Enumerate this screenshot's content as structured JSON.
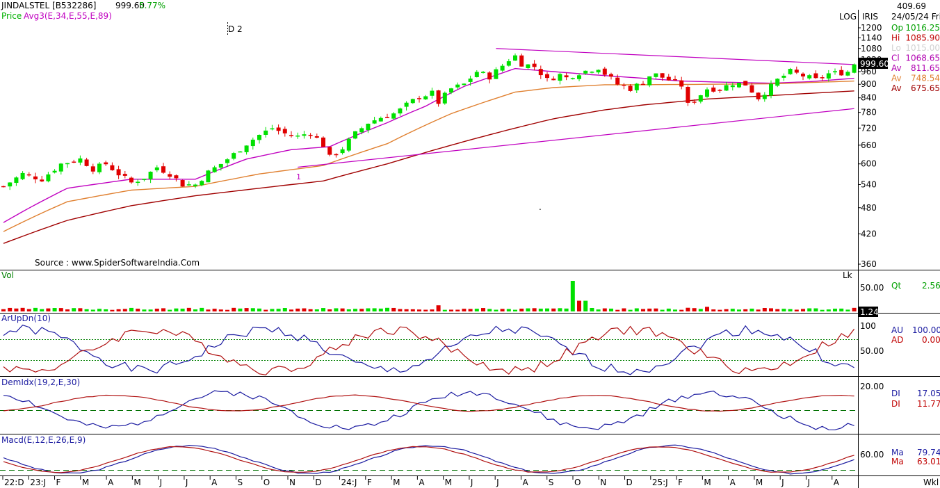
{
  "header": {
    "symbol": "JINDALSTEL [B532286]",
    "last": "999.60",
    "change_pct": "5.77%",
    "price_label": "Price",
    "avg_label": "Avg3(E,34,E,55,E,89)",
    "marker": "D 2",
    "wave_label": "1",
    "source": "Source : www.SpiderSoftwareIndia.Com",
    "dot": "."
  },
  "right_panel": {
    "volume_top": "409.69",
    "date": "24/05/24 Fri",
    "log_label": "LOG",
    "iris_label": "IRIS",
    "rows": [
      {
        "label": "Op",
        "value": "1016.25",
        "color": "#00a000"
      },
      {
        "label": "Hi",
        "value": "1085.90",
        "color": "#c00000"
      },
      {
        "label": "Lo",
        "value": "1015.00",
        "color": "#d0d0d0"
      },
      {
        "label": "Cl",
        "value": "1068.65",
        "color": "#b000b0"
      },
      {
        "label": "Av",
        "value": "811.65",
        "color": "#b000b0"
      },
      {
        "label": "Av",
        "value": "748.54",
        "color": "#e08030"
      },
      {
        "label": "Av",
        "value": "675.65",
        "color": "#a00000"
      }
    ],
    "price_tag": "999.60",
    "vol_tag": "1.24",
    "vol_unit": "Lk",
    "qt_label": "Qt",
    "qt_value": "2.56",
    "au_label": "AU",
    "au_value": "100.00",
    "ad_label": "AD",
    "ad_value": "0.00",
    "di_plus_label": "DI",
    "di_plus_value": "17.05",
    "di_minus_label": "DI",
    "di_minus_value": "11.77",
    "ma1_label": "Ma",
    "ma1_value": "79.74",
    "ma2_label": "Ma",
    "ma2_value": "63.01",
    "period": "Wkl"
  },
  "panels": {
    "vol_title": "Vol",
    "aroon_title": "ArUpDn(10)",
    "dmi_title": "DemIdx(19,2,E,30)",
    "macd_title": "Macd(E,12,E,26,E,9)"
  },
  "colors": {
    "up": "#00e000",
    "down": "#e00000",
    "ema34": "#c000c0",
    "ema55": "#e08030",
    "ema89": "#a00000",
    "trend": "#c000c0",
    "blue": "#1a1aa0",
    "red": "#b01010"
  },
  "chart_data": [
    {
      "type": "candlestick",
      "scale": "log",
      "y_ticks": [
        "1200",
        "1140",
        "1080",
        "1020",
        "960",
        "900",
        "840",
        "780",
        "720",
        "660",
        "600",
        "540",
        "480",
        "420",
        "360"
      ],
      "x_ticks": [
        "22:D",
        "23:J",
        "F",
        "M",
        "A",
        "M",
        "J",
        "J",
        "A",
        "S",
        "O",
        "N",
        "D",
        "24:J",
        "F",
        "M",
        "A",
        "M",
        "J",
        "J",
        "A",
        "S",
        "O",
        "N",
        "D",
        "25:J",
        "F",
        "M",
        "A",
        "M",
        "J",
        "J",
        "A"
      ],
      "ylim": [
        360,
        1200
      ],
      "close_path": [
        [
          0,
          535
        ],
        [
          3,
          570
        ],
        [
          6,
          555
        ],
        [
          9,
          600
        ],
        [
          12,
          615
        ],
        [
          14,
          585
        ],
        [
          16,
          600
        ],
        [
          18,
          570
        ],
        [
          20,
          545
        ],
        [
          22,
          560
        ],
        [
          24,
          590
        ],
        [
          26,
          570
        ],
        [
          28,
          540
        ],
        [
          30,
          540
        ],
        [
          32,
          575
        ],
        [
          34,
          600
        ],
        [
          36,
          630
        ],
        [
          38,
          665
        ],
        [
          40,
          695
        ],
        [
          42,
          720
        ],
        [
          44,
          700
        ],
        [
          46,
          690
        ],
        [
          48,
          705
        ],
        [
          50,
          660
        ],
        [
          51,
          620
        ],
        [
          53,
          650
        ],
        [
          55,
          700
        ],
        [
          57,
          740
        ],
        [
          59,
          760
        ],
        [
          61,
          775
        ],
        [
          62,
          790
        ],
        [
          63,
          810
        ],
        [
          65,
          845
        ],
        [
          67,
          860
        ],
        [
          68,
          820
        ],
        [
          70,
          880
        ],
        [
          72,
          900
        ],
        [
          74,
          960
        ],
        [
          76,
          935
        ],
        [
          78,
          990
        ],
        [
          79,
          1020
        ],
        [
          80,
          1040
        ],
        [
          81,
          1000
        ],
        [
          83,
          985
        ],
        [
          85,
          920
        ],
        [
          87,
          945
        ],
        [
          88,
          930
        ],
        [
          90,
          955
        ],
        [
          93,
          980
        ],
        [
          94,
          950
        ],
        [
          96,
          900
        ],
        [
          98,
          880
        ],
        [
          100,
          910
        ],
        [
          101,
          940
        ],
        [
          102,
          945
        ],
        [
          104,
          920
        ],
        [
          106,
          895
        ],
        [
          107,
          810
        ],
        [
          108,
          830
        ],
        [
          110,
          880
        ],
        [
          112,
          880
        ],
        [
          114,
          905
        ],
        [
          116,
          900
        ],
        [
          118,
          840
        ],
        [
          120,
          890
        ],
        [
          121,
          920
        ],
        [
          123,
          960
        ],
        [
          125,
          940
        ],
        [
          127,
          920
        ],
        [
          129,
          950
        ],
        [
          131,
          955
        ],
        [
          132,
          960
        ],
        [
          133,
          1000
        ]
      ],
      "ema34_path": [
        [
          0,
          445
        ],
        [
          10,
          530
        ],
        [
          20,
          555
        ],
        [
          30,
          555
        ],
        [
          38,
          615
        ],
        [
          45,
          645
        ],
        [
          51,
          655
        ],
        [
          60,
          740
        ],
        [
          66,
          805
        ],
        [
          72,
          890
        ],
        [
          80,
          975
        ],
        [
          86,
          960
        ],
        [
          92,
          945
        ],
        [
          100,
          928
        ],
        [
          106,
          915
        ],
        [
          112,
          910
        ],
        [
          120,
          905
        ],
        [
          126,
          912
        ],
        [
          133,
          928
        ]
      ],
      "ema55_path": [
        [
          0,
          425
        ],
        [
          10,
          495
        ],
        [
          20,
          525
        ],
        [
          30,
          535
        ],
        [
          40,
          570
        ],
        [
          50,
          595
        ],
        [
          60,
          665
        ],
        [
          70,
          775
        ],
        [
          80,
          865
        ],
        [
          86,
          885
        ],
        [
          94,
          898
        ],
        [
          100,
          898
        ],
        [
          110,
          900
        ],
        [
          120,
          902
        ],
        [
          133,
          915
        ]
      ],
      "ema89_path": [
        [
          0,
          400
        ],
        [
          10,
          450
        ],
        [
          20,
          485
        ],
        [
          30,
          510
        ],
        [
          40,
          530
        ],
        [
          50,
          550
        ],
        [
          60,
          600
        ],
        [
          70,
          660
        ],
        [
          80,
          720
        ],
        [
          86,
          755
        ],
        [
          94,
          790
        ],
        [
          100,
          810
        ],
        [
          110,
          835
        ],
        [
          120,
          850
        ],
        [
          133,
          870
        ]
      ],
      "trendlines": [
        {
          "from": [
            46,
            590
          ],
          "to": [
            133,
            795
          ]
        },
        {
          "from": [
            77,
            1080
          ],
          "to": [
            133,
            995
          ]
        }
      ]
    },
    {
      "type": "bar",
      "name": "Vol",
      "y_ticks": [
        "50.00"
      ],
      "spikes": [
        [
          68,
          0.2
        ],
        [
          89,
          1.0
        ],
        [
          90,
          0.35
        ],
        [
          91,
          0.35
        ],
        [
          107,
          0.12
        ],
        [
          110,
          0.15
        ]
      ]
    },
    {
      "type": "line",
      "name": "ArUpDn(10)",
      "y_ticks": [
        "100",
        "50.00"
      ],
      "levels": [
        70,
        30
      ]
    },
    {
      "type": "line",
      "name": "DemIdx(19,2,E,30)",
      "y_ticks": [
        "20.00"
      ]
    },
    {
      "type": "line",
      "name": "Macd(E,12,E,26,E,9)",
      "y_ticks": [
        "60.00"
      ]
    }
  ]
}
